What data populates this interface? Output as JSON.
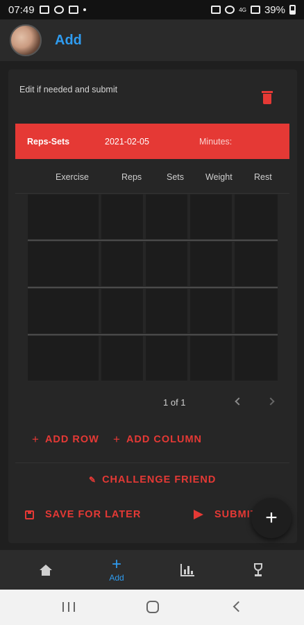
{
  "status_bar": {
    "time": "07:49",
    "battery": "39%",
    "signal_text": "4G"
  },
  "header": {
    "title": "Add",
    "avatar": "profile-photo"
  },
  "card": {
    "subtitle": "Edit if needed and submit",
    "workout": {
      "type": "Reps-Sets",
      "date": "2021-02-05",
      "minutes_label": "Minutes:"
    },
    "columns": [
      "Exercise",
      "Reps",
      "Sets",
      "Weight",
      "Rest"
    ],
    "rows": 4,
    "pager": {
      "text": "1 of 1"
    },
    "add_row_label": "ADD ROW",
    "add_column_label": "ADD COLUMN",
    "challenge_label": "CHALLENGE FRIEND",
    "save_label": "SAVE FOR LATER",
    "submit_label": "SUBMIT"
  },
  "fab": {
    "icon": "plus-icon"
  },
  "bottom_nav": {
    "items": [
      {
        "icon": "home-icon",
        "label": ""
      },
      {
        "icon": "plus-icon",
        "label": "Add"
      },
      {
        "icon": "bar-chart-icon",
        "label": ""
      },
      {
        "icon": "trophy-icon",
        "label": ""
      }
    ]
  },
  "colors": {
    "accent": "#e53935",
    "nav_active": "#2f9cf0",
    "background": "#1f1f1f"
  }
}
